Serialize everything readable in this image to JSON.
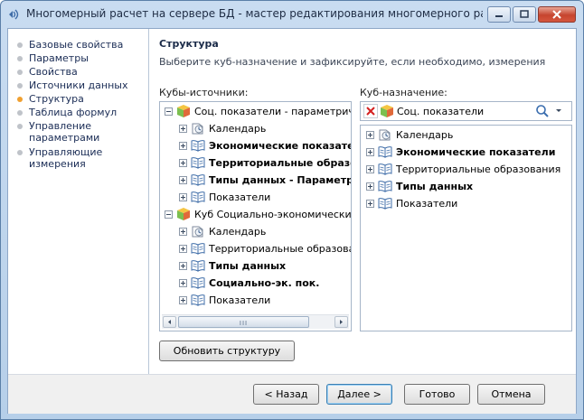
{
  "window": {
    "title": "Многомерный расчет на сервере БД - мастер редактирования многомерного расчета на ...",
    "accent": "#f0a030"
  },
  "sidebar": {
    "items": [
      {
        "label": "Базовые свойства",
        "active": false
      },
      {
        "label": "Параметры",
        "active": false
      },
      {
        "label": "Свойства",
        "active": false
      },
      {
        "label": "Источники данных",
        "active": false
      },
      {
        "label": "Структура",
        "active": true
      },
      {
        "label": "Таблица формул",
        "active": false
      },
      {
        "label": "Управление параметрами",
        "active": false
      },
      {
        "label": "Управляющие измерения",
        "active": false
      }
    ]
  },
  "main": {
    "heading": "Структура",
    "description": "Выберите куб-назначение и зафиксируйте, если необходимо, измерения",
    "sources_label": "Кубы-источники:",
    "target_label": "Куб-назначение:",
    "target_value": "Соц. показатели",
    "refresh_button": "Обновить структуру"
  },
  "source_tree": [
    {
      "level": 0,
      "expander": "minus",
      "icon": "cube-icon",
      "label": "Соц. показатели - параметрические",
      "bold": false
    },
    {
      "level": 1,
      "expander": "plus",
      "icon": "calendar-dimension-icon",
      "label": "Календарь",
      "bold": false
    },
    {
      "level": 1,
      "expander": "plus",
      "icon": "dimension-book-icon",
      "label": "Экономические показатели",
      "bold": true
    },
    {
      "level": 1,
      "expander": "plus",
      "icon": "dimension-book-icon",
      "label": "Территориальные образования",
      "bold": true
    },
    {
      "level": 1,
      "expander": "plus",
      "icon": "dimension-book-icon",
      "label": "Типы данных - Параметрические",
      "bold": true
    },
    {
      "level": 1,
      "expander": "plus",
      "icon": "dimension-book-icon",
      "label": "Показатели",
      "bold": false
    },
    {
      "level": 0,
      "expander": "minus",
      "icon": "cube-icon",
      "label": "Куб Социально-экономические показатели",
      "bold": false
    },
    {
      "level": 1,
      "expander": "plus",
      "icon": "calendar-dimension-icon",
      "label": "Календарь",
      "bold": false
    },
    {
      "level": 1,
      "expander": "plus",
      "icon": "dimension-book-icon",
      "label": "Территориальные образования",
      "bold": false
    },
    {
      "level": 1,
      "expander": "plus",
      "icon": "dimension-book-icon",
      "label": "Типы данных",
      "bold": true
    },
    {
      "level": 1,
      "expander": "plus",
      "icon": "dimension-book-icon",
      "label": "Социально-эк. пок.",
      "bold": true
    },
    {
      "level": 1,
      "expander": "plus",
      "icon": "dimension-book-icon",
      "label": "Показатели",
      "bold": false
    }
  ],
  "target_tree": [
    {
      "icon": "calendar-dimension-icon",
      "label": "Календарь",
      "bold": false
    },
    {
      "icon": "dimension-book-icon",
      "label": "Экономические показатели",
      "bold": true
    },
    {
      "icon": "dimension-book-icon",
      "label": "Территориальные образования",
      "bold": false
    },
    {
      "icon": "dimension-book-icon",
      "label": "Типы данных",
      "bold": true
    },
    {
      "icon": "dimension-book-icon",
      "label": "Показатели",
      "bold": false
    }
  ],
  "footer": {
    "back": "< Назад",
    "next": "Далее >",
    "finish": "Готово",
    "cancel": "Отмена"
  },
  "scroll_glyph": "III"
}
